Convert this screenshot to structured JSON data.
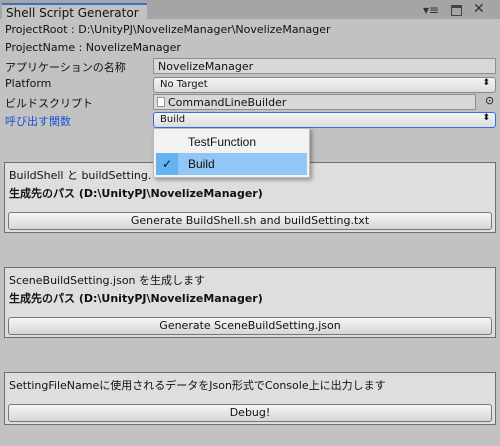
{
  "window": {
    "tab_title": "Shell Script Generator",
    "controls": [
      "menu-icon",
      "maximize-icon",
      "close-icon"
    ]
  },
  "info": {
    "project_root": "ProjectRoot : D:\\UnityPJ\\NovelizeManager\\NovelizeManager",
    "project_name": "ProjectName : NovelizeManager"
  },
  "form": {
    "app_name_label": "アプリケーションの名称",
    "app_name_value": "NovelizeManager",
    "platform_label": "Platform",
    "platform_value": "No Target",
    "build_script_label": "ビルドスクリプト",
    "build_script_value": "CommandLineBuilder",
    "function_label": "呼び出す関数",
    "function_value": "Build",
    "function_label_color": "#1a4fd6"
  },
  "dropdown": {
    "options": [
      {
        "label": "TestFunction",
        "selected": false
      },
      {
        "label": "Build",
        "selected": true
      }
    ]
  },
  "sections": [
    {
      "description": "BuildShell と buildSetting.",
      "path": "生成先のパス (D:\\UnityPJ\\NovelizeManager)",
      "button": "Generate BuildShell.sh and buildSetting.txt"
    },
    {
      "description": "SceneBuildSetting.json を生成します",
      "path": "生成先のパス (D:\\UnityPJ\\NovelizeManager)",
      "button": "Generate SceneBuildSetting.json"
    },
    {
      "description": "SettingFileNameに使用されるデータをJson形式でConsole上に出力します",
      "button": "Debug!"
    }
  ]
}
